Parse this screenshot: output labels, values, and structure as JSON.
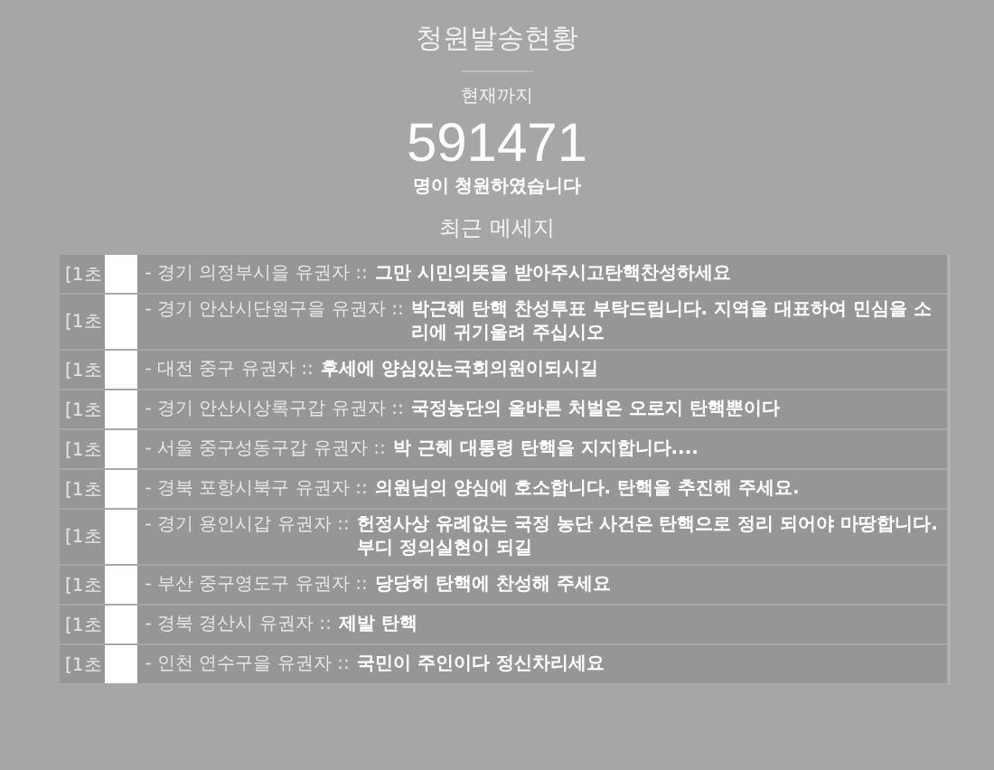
{
  "title": "청원발송현황",
  "subtitle": "현재까지",
  "count": "591471",
  "count_caption": "명이 청원하였습니다",
  "section_title": "최근 메세지",
  "messages": [
    {
      "time": "[1초",
      "region": "- 경기 의정부시을 유권자 ::",
      "text": "그만 시민의뜻을 받아주시고탄핵찬성하세요"
    },
    {
      "time": "[1초",
      "region": "- 경기 안산시단원구을 유권자 ::",
      "text": "박근혜 탄핵 찬성투표 부탁드립니다. 지역을 대표하여 민심을 소리에 귀기울려 주십시오"
    },
    {
      "time": "[1초",
      "region": "- 대전 중구 유권자 ::",
      "text": "후세에 양심있는국회의원이되시길"
    },
    {
      "time": "[1초",
      "region": "- 경기 안산시상록구갑 유권자 ::",
      "text": "국정농단의 올바른 처벌은 오로지 탄핵뿐이다"
    },
    {
      "time": "[1초",
      "region": "- 서울 중구성동구갑 유권자 ::",
      "text": "박 근혜 대통령 탄핵을 지지합니다...."
    },
    {
      "time": "[1초",
      "region": "- 경북 포항시북구 유권자 ::",
      "text": "의원님의 양심에 호소합니다. 탄핵을 추진해 주세요."
    },
    {
      "time": "[1초",
      "region": "- 경기 용인시갑 유권자 ::",
      "text": "헌정사상 유례없는 국정 농단 사건은 탄핵으로 정리 되어야 마땅합니다. 부디 정의실현이 되길"
    },
    {
      "time": "[1초",
      "region": "- 부산 중구영도구 유권자 ::",
      "text": "당당히 탄핵에 찬성해 주세요"
    },
    {
      "time": "[1초",
      "region": "- 경북 경산시 유권자 ::",
      "text": "제발 탄핵"
    },
    {
      "time": "[1초",
      "region": "- 인천 연수구을 유권자 ::",
      "text": "국민이 주인이다 정신차리세요"
    }
  ]
}
